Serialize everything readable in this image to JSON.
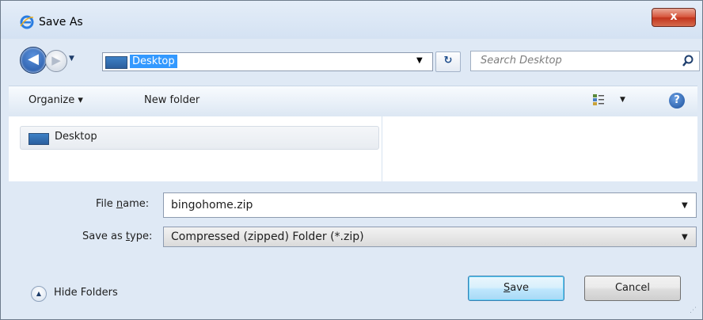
{
  "window": {
    "title": "Save As",
    "close_label": "x"
  },
  "nav": {
    "back_glyph": "◀",
    "forward_glyph": "▶",
    "address": "Desktop",
    "refresh_glyph": "↻",
    "search_placeholder": "Search Desktop"
  },
  "toolbar": {
    "organize": "Organize ▾",
    "new_folder": "New folder",
    "help_glyph": "?"
  },
  "folders": {
    "items": [
      {
        "label": "Desktop",
        "icon": "desktop-icon"
      }
    ]
  },
  "form": {
    "file_name_label_pre": "File ",
    "file_name_label_key": "n",
    "file_name_label_post": "ame:",
    "file_name_value": "bingohome.zip",
    "save_type_label_pre": "Save as ",
    "save_type_label_key": "t",
    "save_type_label_post": "ype:",
    "save_type_value": "Compressed (zipped) Folder (*.zip)"
  },
  "footer": {
    "hide_folders": "Hide Folders",
    "save_key": "S",
    "save_rest": "ave",
    "cancel": "Cancel"
  },
  "colors": {
    "selection": "#3399ff",
    "close_button": "#c2341d",
    "window_frame": "#dfe9f5"
  }
}
